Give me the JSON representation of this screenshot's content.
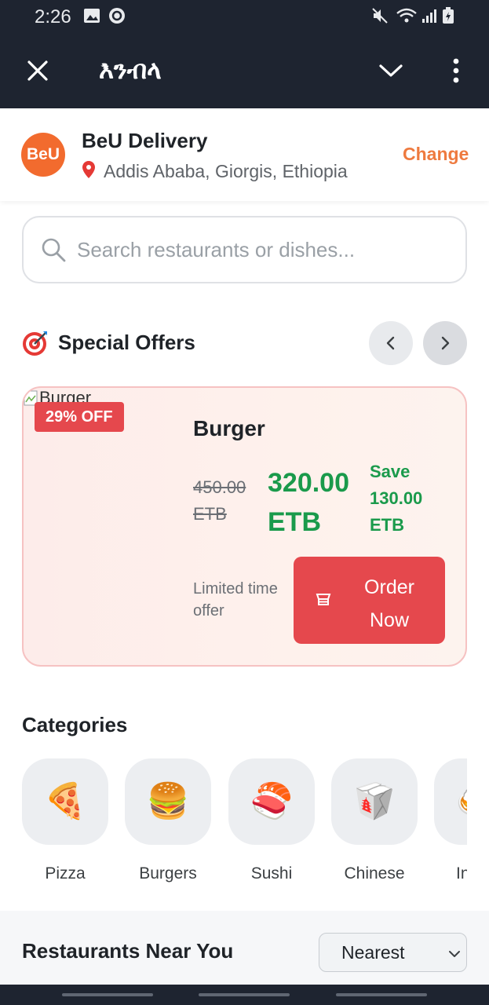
{
  "status_bar": {
    "time": "2:26"
  },
  "app_bar": {
    "title": "እንብላ"
  },
  "header": {
    "logo_text": "BeU",
    "brand_name": "BeU Delivery",
    "location": "Addis Ababa, Giorgis, Ethiopia",
    "change_label": "Change"
  },
  "search": {
    "placeholder": "Search restaurants or dishes..."
  },
  "special_offers": {
    "title": "Special Offers",
    "card": {
      "image_alt": "Burger",
      "badge": "29% OFF",
      "dish_name": "Burger",
      "old_price": "450.00 ETB",
      "new_price": "320.00 ETB",
      "save_text": "Save 130.00 ETB",
      "limited_text": "Limited time offer",
      "order_label": "Order Now"
    }
  },
  "categories": {
    "title": "Categories",
    "items": [
      {
        "label": "Pizza",
        "icon": "🍕"
      },
      {
        "label": "Burgers",
        "icon": "🍔"
      },
      {
        "label": "Sushi",
        "icon": "🍣"
      },
      {
        "label": "Chinese",
        "icon": "🥡"
      },
      {
        "label": "In",
        "icon": "🍛"
      }
    ]
  },
  "restaurants": {
    "title": "Restaurants Near You",
    "sort_value": "Nearest"
  },
  "colors": {
    "accent": "#f26b2e",
    "offer_red": "#e5484d",
    "price_green": "#1a9a4b",
    "appbar_bg": "#1e2430"
  }
}
